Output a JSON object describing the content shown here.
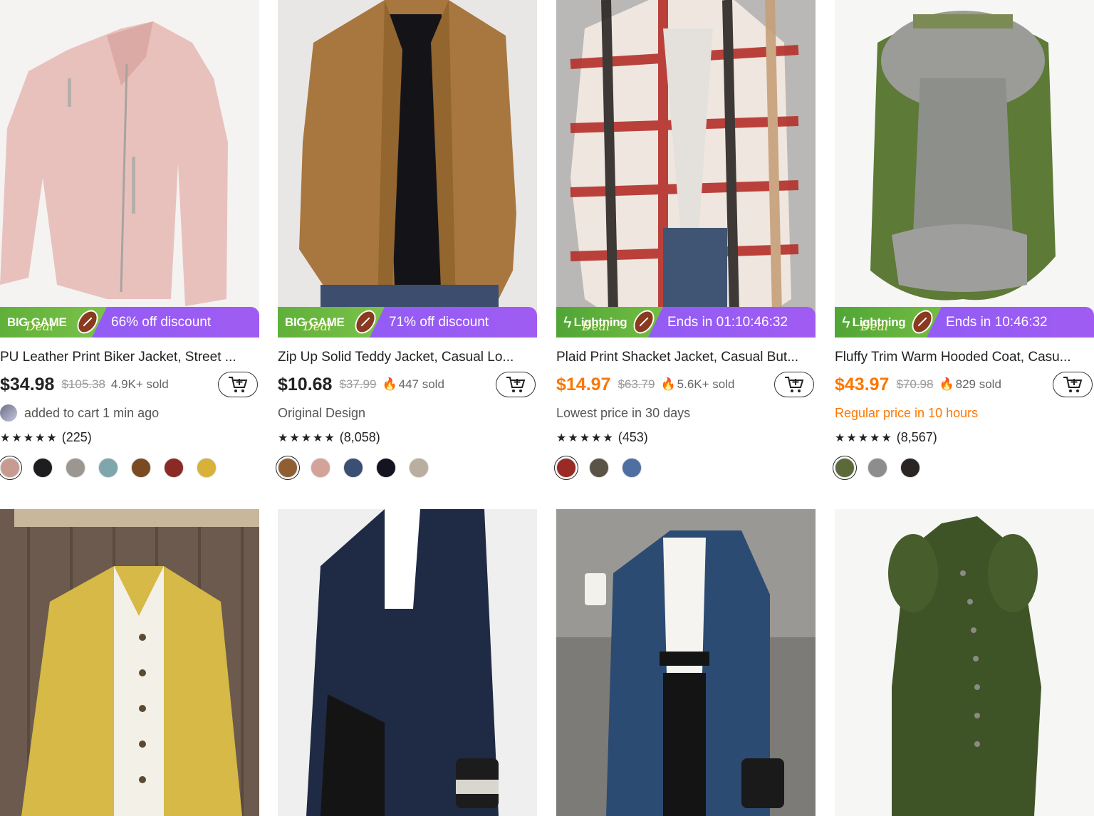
{
  "products": [
    {
      "title": "PU Leather Print Biker Jacket, Street ...",
      "badge_type": "big",
      "badge_line1": "BIG GAME",
      "badge_line2": "Deal",
      "badge_text": "66% off discount",
      "price": "$34.98",
      "price_color": "default",
      "old_price": "$105.38",
      "sold": "4.9K+ sold",
      "hot": false,
      "sub_text": "added to cart 1 min ago",
      "stars": "★★★★★",
      "reviews": "(225)",
      "swatches": [
        "#c79b92",
        "#1d1d1f",
        "#9b9790",
        "#7fa6ad",
        "#7a4a23",
        "#8b2a25",
        "#d8b13a"
      ]
    },
    {
      "title": "Zip Up Solid Teddy Jacket, Casual Lo...",
      "badge_type": "big",
      "badge_line1": "BIG GAME",
      "badge_line2": "Deal",
      "badge_text": "71% off discount",
      "price": "$10.68",
      "price_color": "default",
      "old_price": "$37.99",
      "sold": "447 sold",
      "hot": true,
      "sub_text": "Original Design",
      "stars": "★★★★★",
      "reviews": "(8,058)",
      "swatches": [
        "#8f5e33",
        "#d3a39a",
        "#3b4f74",
        "#141421",
        "#b9aea0"
      ]
    },
    {
      "title": "Plaid Print Shacket Jacket, Casual But...",
      "badge_type": "light",
      "badge_line1": "Lightning",
      "badge_line2": "Deal",
      "badge_text": "Ends in 01:10:46:32",
      "price": "$14.97",
      "price_color": "orange",
      "old_price": "$63.79",
      "sold": "5.6K+ sold",
      "hot": true,
      "sub_text": "Lowest price in 30 days",
      "stars": "★★★★★",
      "reviews": "(453)",
      "swatches": [
        "#9a2a24",
        "#5a5446",
        "#4f6fa3"
      ]
    },
    {
      "title": "Fluffy Trim Warm Hooded Coat, Casu...",
      "badge_type": "light",
      "badge_line1": "Lightning",
      "badge_line2": "Deal",
      "badge_text": "Ends in 10:46:32",
      "price": "$43.97",
      "price_color": "orange",
      "old_price": "$70.98",
      "sold": "829 sold",
      "hot": true,
      "sub_text": "Regular price in 10 hours",
      "stars": "★★★★★",
      "reviews": "(8,567)",
      "swatches": [
        "#5c6a3a",
        "#8d8d8d",
        "#2a2523"
      ]
    }
  ],
  "icons": {
    "cart": "add-to-cart-icon",
    "flame": "flame-icon",
    "bolt": "lightning-icon",
    "football": "football-icon"
  },
  "colors": {
    "accent_orange": "#fb7701",
    "banner_purple": "#8b5cf6",
    "banner_green": "#5fb03a"
  }
}
